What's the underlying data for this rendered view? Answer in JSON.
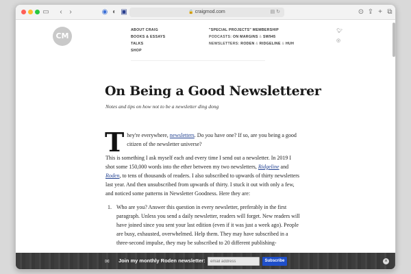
{
  "browser": {
    "url": "craigmod.com",
    "tab_icons": [
      "sidebar-icon",
      "back-icon",
      "forward-icon",
      "shield-icon",
      "contrast-icon",
      "bookmark-icon"
    ],
    "right_icons": [
      "download-icon",
      "share-icon",
      "new-tab-icon",
      "tabs-icon"
    ]
  },
  "site": {
    "logo_text": "CM",
    "nav_left": [
      "ABOUT CRAIG",
      "BOOKS & ESSAYS",
      "TALKS",
      "SHOP"
    ],
    "nav_right": {
      "special_projects": "\"SPECIAL PROJECTS\" MEMBERSHIP",
      "podcasts_label": "PODCASTS:",
      "podcast_1": "ON MARGINS",
      "podcast_sep": "&",
      "podcast_2": "SW945",
      "newsletters_label": "NEWSLETTERS:",
      "newsletter_1": "RODEN",
      "newsletter_sep1": "&",
      "newsletter_2": "RIDGELINE",
      "newsletter_sep2": "&",
      "newsletter_3": "HUH"
    },
    "social": [
      "twitter-icon",
      "instagram-icon"
    ]
  },
  "article": {
    "title": "On Being a Good Newsletterer",
    "subtitle": "Notes and tips on how not to be a newsletter ding dong",
    "dropcap": "T",
    "p1_a": "hey're everywhere, ",
    "p1_link": "newsletters",
    "p1_b": ". Do ",
    "p1_em": "you",
    "p1_c": " have one? If so, are you being a good citizen of the newsletter universe?",
    "p2_a": "This is something I ask myself each and every time I send out a newsletter. In 2019 I shot some 150,000 words into the ether between my two newsletters, ",
    "p2_link1": "Ridgeline",
    "p2_b": " and ",
    "p2_link2": "Roden",
    "p2_c": ", to tens of thousands of readers. I also subscribed to upwards of thirty newsletters last year. And then unsubscribed from upwards of thirty. I stuck it out with only a few, and noticed some patterns in Newsletter Goodness. Here they are:",
    "list_num_1": "1.",
    "list_item_1": "Who are you? Answer this question in every newsletter, preferably in the first paragraph. Unless you send a daily newsletter, readers will forget. New readers will have joined since you sent your last edition (even if it was just a week ago). People are busy, exhausted, overwhelmed. Help them. They may have subscribed in a three-second impulse, they may be subscribed to 20 different publishing-"
  },
  "banner": {
    "label": "Join my monthly Roden newsletter:",
    "input_placeholder": "email address",
    "button": "Subscribe",
    "close": "×"
  }
}
